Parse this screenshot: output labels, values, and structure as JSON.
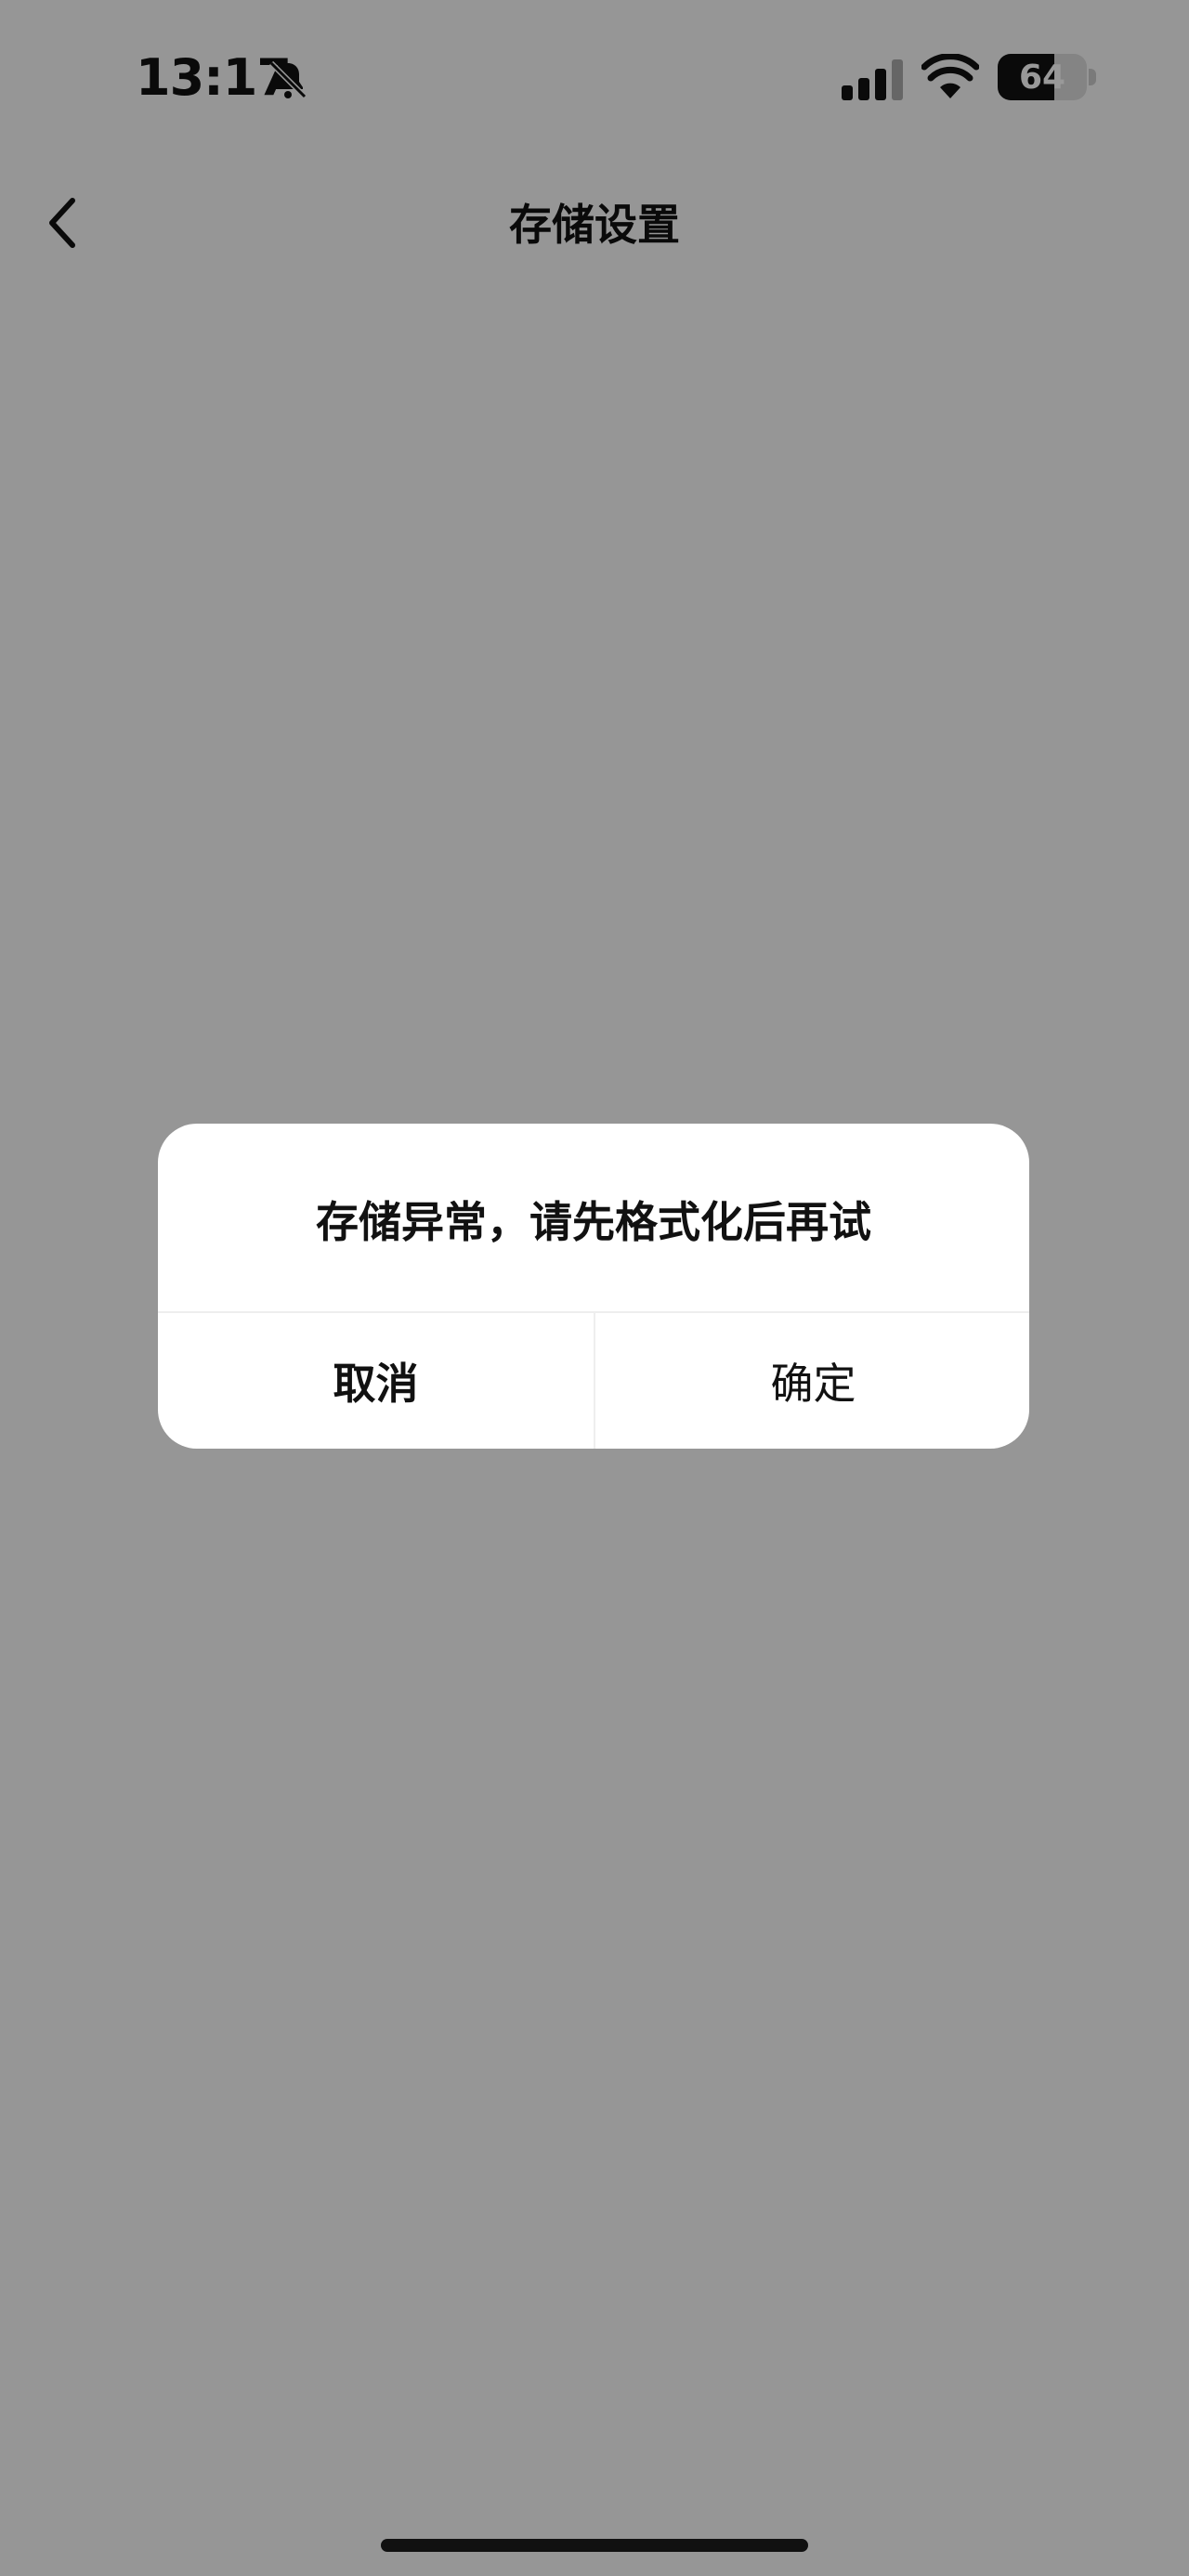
{
  "status_bar": {
    "time": "13:17",
    "battery_text": "64",
    "battery_level": 0.64
  },
  "nav": {
    "title": "存储设置"
  },
  "dialog": {
    "message": "存储异常，请先格式化后再试",
    "cancel_label": "取消",
    "confirm_label": "确定"
  },
  "icons": {
    "back": "chevron-left-icon",
    "bell": "bell-slash-icon",
    "signal": "signal-icon",
    "wifi": "wifi-icon",
    "battery": "battery-icon"
  },
  "colors": {
    "overlay": "#000000",
    "dialog_bg": "#ffffff",
    "text": "#111111"
  }
}
